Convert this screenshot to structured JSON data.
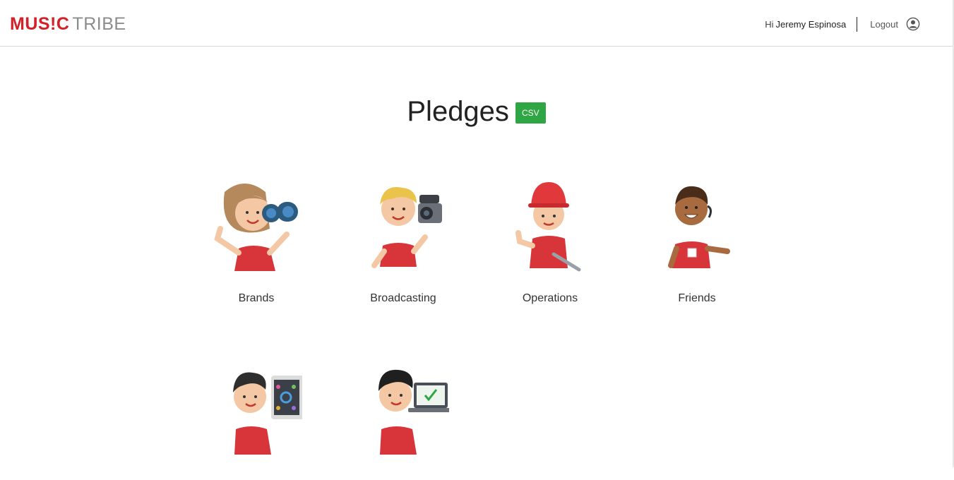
{
  "header": {
    "logo": {
      "part1": "MUS!C",
      "part2": "TRIBE"
    },
    "greeting_prefix": "Hi",
    "user_name": "Jeremy Espinosa",
    "logout_label": "Logout",
    "icons": {
      "user": "user-circle-icon"
    }
  },
  "page": {
    "title": "Pledges",
    "csv_label": "CSV"
  },
  "categories": [
    {
      "label": "Brands",
      "icon": "binoculars-woman-icon"
    },
    {
      "label": "Broadcasting",
      "icon": "video-camera-man-icon"
    },
    {
      "label": "Operations",
      "icon": "hardhat-wrench-worker-icon"
    },
    {
      "label": "Friends",
      "icon": "headset-support-man-icon"
    },
    {
      "label": "",
      "icon": "tablet-designer-icon"
    },
    {
      "label": "",
      "icon": "laptop-checklist-man-icon"
    }
  ],
  "colors": {
    "brand_red": "#d42127",
    "brand_gray": "#8c8c8c",
    "csv_green": "#2fa644",
    "shirt_red": "#e0383b"
  }
}
